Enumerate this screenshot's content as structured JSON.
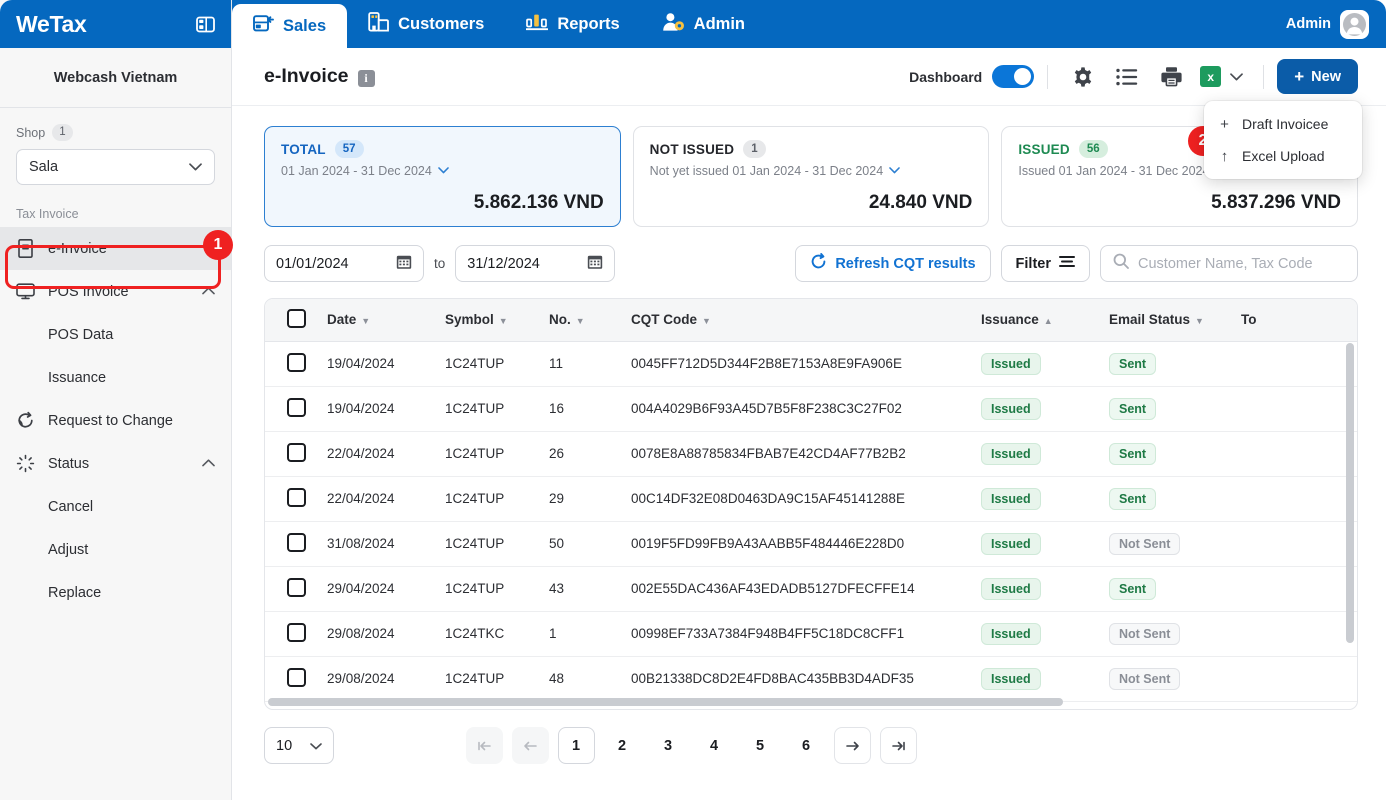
{
  "sidebar": {
    "logo": "WeTax",
    "panel_icon": "panel-toggle-icon",
    "company": "Webcash Vietnam",
    "shop_label": "Shop",
    "shop_count": "1",
    "shop_selected": "Sala",
    "section_label": "Tax Invoice",
    "items": [
      {
        "label": "e-Invoice",
        "icon": "invoice-icon",
        "active": true,
        "type": "item"
      },
      {
        "label": "POS Invoice",
        "icon": "monitor-icon",
        "expandable": true,
        "type": "item"
      },
      {
        "label": "POS Data",
        "type": "sub"
      },
      {
        "label": "Issuance",
        "type": "sub"
      },
      {
        "label": "Request to Change",
        "icon": "refresh-circle-icon",
        "type": "item"
      },
      {
        "label": "Status",
        "icon": "spinner-icon",
        "expandable": true,
        "type": "item"
      },
      {
        "label": "Cancel",
        "type": "sub"
      },
      {
        "label": "Adjust",
        "type": "sub"
      },
      {
        "label": "Replace",
        "type": "sub"
      }
    ]
  },
  "topnav": {
    "tabs": [
      {
        "label": "Sales",
        "icon": "sales-icon",
        "active": true
      },
      {
        "label": "Customers",
        "icon": "building-icon",
        "active": false
      },
      {
        "label": "Reports",
        "icon": "bar-chart-icon",
        "active": false
      },
      {
        "label": "Admin",
        "icon": "user-gear-icon",
        "active": false
      }
    ],
    "admin_label": "Admin",
    "avatar_icon": "user-avatar-icon"
  },
  "header": {
    "title": "e-Invoice",
    "info_icon": "info-icon",
    "dashboard_label": "Dashboard",
    "dashboard_on": true,
    "icons": [
      {
        "name": "gear-icon"
      },
      {
        "name": "list-icon"
      },
      {
        "name": "print-icon"
      },
      {
        "name": "excel-icon",
        "glyph": "x"
      }
    ],
    "new_button": "New",
    "plus_glyph": "+"
  },
  "dropdown": {
    "items": [
      {
        "label": "Draft Invoicee",
        "icon": "plus-icon",
        "glyph": "+"
      },
      {
        "label": "Excel Upload",
        "icon": "upload-arrow-icon",
        "glyph": "↑",
        "highlighted": true
      }
    ]
  },
  "cards": [
    {
      "key": "total",
      "title": "TOTAL",
      "count": "57",
      "subtitle": "01 Jan 2024 - 31 Dec 2024",
      "amount": "5.862.136 VND"
    },
    {
      "key": "notissued",
      "title": "NOT ISSUED",
      "count": "1",
      "subtitle": "Not yet issued 01 Jan 2024 - 31 Dec 2024",
      "amount": "24.840 VND"
    },
    {
      "key": "issued",
      "title": "ISSUED",
      "count": "56",
      "subtitle": "Issued 01 Jan 2024 - 31 Dec 2024",
      "amount": "5.837.296 VND"
    }
  ],
  "filters": {
    "date_from": "01/01/2024",
    "date_to": "31/12/2024",
    "to_label": "to",
    "calendar_icon": "calendar-icon",
    "refresh_label": "Refresh CQT results",
    "refresh_icon": "refresh-icon",
    "filter_label": "Filter",
    "filter_icon": "filter-icon",
    "search_placeholder": "Customer Name, Tax Code",
    "search_value": "",
    "search_icon": "search-icon"
  },
  "table": {
    "columns": [
      {
        "key": "checkbox",
        "label": "",
        "sort": ""
      },
      {
        "key": "date",
        "label": "Date",
        "sort": "desc"
      },
      {
        "key": "symbol",
        "label": "Symbol",
        "sort": "desc"
      },
      {
        "key": "no",
        "label": "No.",
        "sort": "desc"
      },
      {
        "key": "cqt",
        "label": "CQT Code",
        "sort": "desc"
      },
      {
        "key": "issuance",
        "label": "Issuance",
        "sort": "asc"
      },
      {
        "key": "email",
        "label": "Email Status",
        "sort": "desc"
      },
      {
        "key": "total",
        "label": "To",
        "sort": ""
      }
    ],
    "rows": [
      {
        "date": "19/04/2024",
        "symbol": "1C24TUP",
        "no": "11",
        "cqt": "0045FF712D5D344F2B8E7153A8E9FA906E",
        "issuance": "Issued",
        "email": "Sent"
      },
      {
        "date": "19/04/2024",
        "symbol": "1C24TUP",
        "no": "16",
        "cqt": "004A4029B6F93A45D7B5F8F238C3C27F02",
        "issuance": "Issued",
        "email": "Sent"
      },
      {
        "date": "22/04/2024",
        "symbol": "1C24TUP",
        "no": "26",
        "cqt": "0078E8A88785834FBAB7E42CD4AF77B2B2",
        "issuance": "Issued",
        "email": "Sent"
      },
      {
        "date": "22/04/2024",
        "symbol": "1C24TUP",
        "no": "29",
        "cqt": "00C14DF32E08D0463DA9C15AF45141288E",
        "issuance": "Issued",
        "email": "Sent"
      },
      {
        "date": "31/08/2024",
        "symbol": "1C24TUP",
        "no": "50",
        "cqt": "0019F5FD99FB9A43AABB5F484446E228D0",
        "issuance": "Issued",
        "email": "Not Sent"
      },
      {
        "date": "29/04/2024",
        "symbol": "1C24TUP",
        "no": "43",
        "cqt": "002E55DAC436AF43EDADB5127DFECFFE14",
        "issuance": "Issued",
        "email": "Sent"
      },
      {
        "date": "29/08/2024",
        "symbol": "1C24TKC",
        "no": "1",
        "cqt": "00998EF733A7384F948B4FF5C18DC8CFF1",
        "issuance": "Issued",
        "email": "Not Sent"
      },
      {
        "date": "29/08/2024",
        "symbol": "1C24TUP",
        "no": "48",
        "cqt": "00B21338DC8D2E4FD8BAC435BB3D4ADF35",
        "issuance": "Issued",
        "email": "Not Sent"
      }
    ]
  },
  "pagination": {
    "page_size": "10",
    "first_glyph": "|←",
    "prev_glyph": "←",
    "next_glyph": "→",
    "last_glyph": "→|",
    "pages": [
      "1",
      "2",
      "3",
      "4",
      "5",
      "6"
    ],
    "current_page": "1"
  },
  "annotations": [
    {
      "number": "1",
      "target": "sidebar-item-e-invoice"
    },
    {
      "number": "2",
      "target": "dropdown-item-excel-upload"
    }
  ],
  "colors": {
    "brand_blue": "#0568bf",
    "accent_blue": "#1565c0",
    "green": "#1e8a52",
    "annotation_red": "#ef2121",
    "excel_green": "#1d9b5e"
  }
}
